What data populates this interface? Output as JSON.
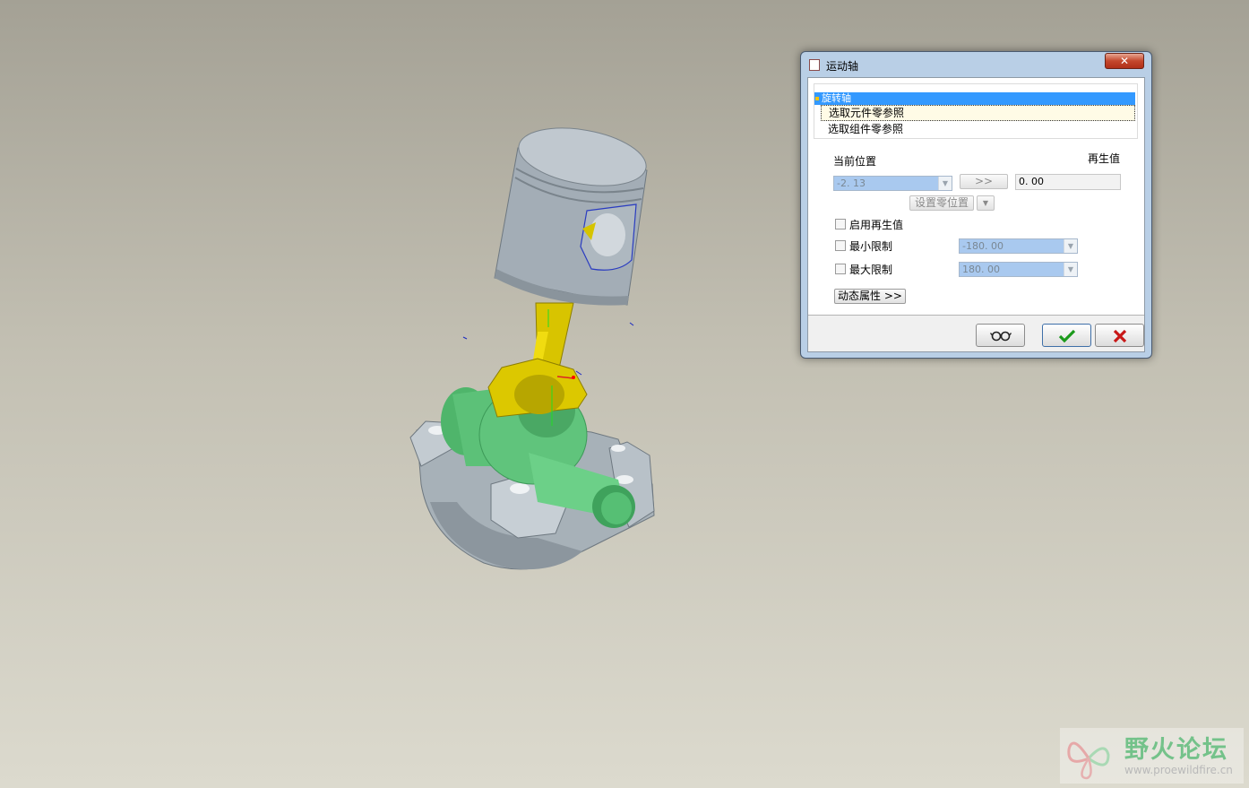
{
  "dialog": {
    "title": "运动轴",
    "close_label": "✕",
    "list": {
      "header": "旋转轴",
      "items": [
        "选取元件零参照",
        "选取组件零参照"
      ]
    },
    "current_position_label": "当前位置",
    "regen_value_label": "再生值",
    "current_position_value": "-2. 13",
    "transfer_label": ">>",
    "regen_value": "0. 00",
    "set_zero_label": "设置零位置",
    "enable_regen_label": "启用再生值",
    "min_limit_label": "最小限制",
    "min_limit_value": "-180. 00",
    "max_limit_label": "最大限制",
    "max_limit_value": "180. 00",
    "dynamic_props_label": "动态属性 >>",
    "preview_icon": "glasses-icon",
    "ok_icon": "check-icon",
    "cancel_icon": "x-icon",
    "colors": {
      "ok": "#1c9a1c",
      "cancel": "#c81818",
      "selection": "#3399ff"
    }
  },
  "watermark": {
    "name": "野火论坛",
    "url": "www.proewildfire.cn"
  }
}
